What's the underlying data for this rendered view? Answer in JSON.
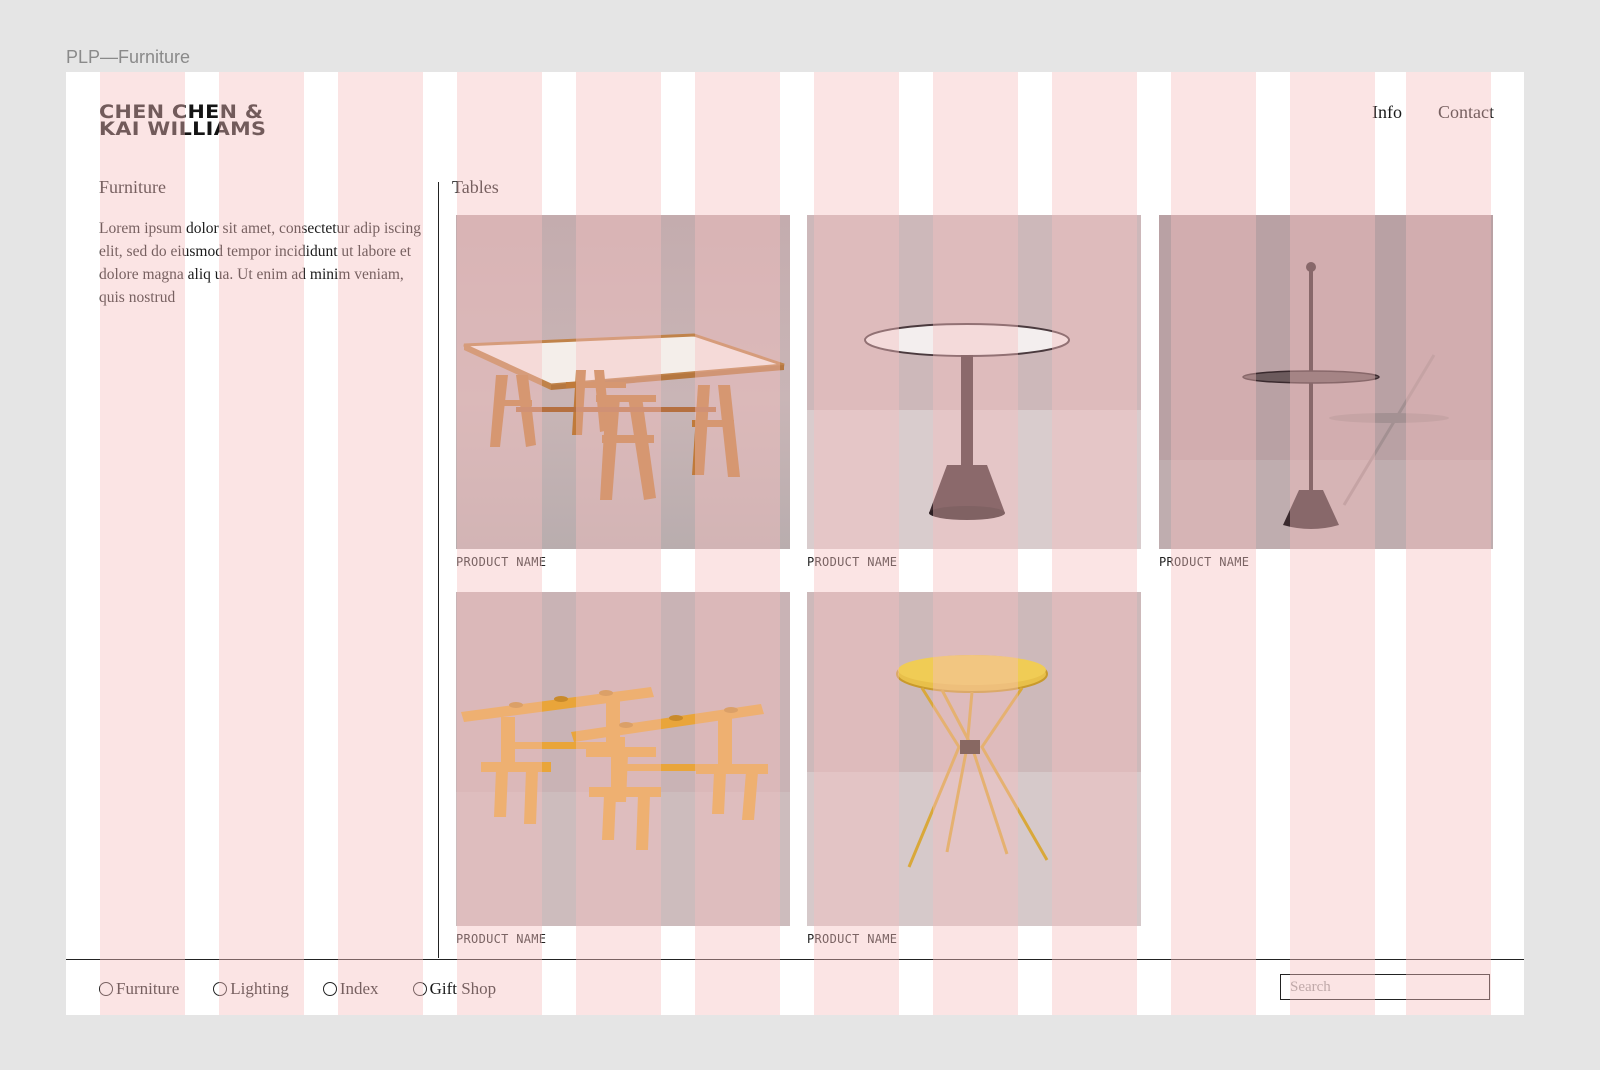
{
  "frame_label": "PLP—Furniture",
  "brand": {
    "line1": "CHEN CHEN &",
    "line2": "KAI WILLIAMS"
  },
  "topnav": {
    "info": "Info",
    "contact": "Contact"
  },
  "sidebar": {
    "title": "Furniture",
    "description": "Lorem ipsum dolor sit amet, consectetur adip iscing elit, sed do eiusmod tempor incididunt ut labore et dolore magna aliq ua. Ut enim ad minim veniam, quis nostrud"
  },
  "section": {
    "title": "Tables"
  },
  "products": [
    {
      "name": "PRODUCT NAME",
      "image": "trestle-table-photo"
    },
    {
      "name": "PRODUCT NAME",
      "image": "round-pedestal-table-photo"
    },
    {
      "name": "PRODUCT NAME",
      "image": "pole-side-table-photo"
    },
    {
      "name": "PRODUCT NAME",
      "image": "yellow-trestles-photo"
    },
    {
      "name": "PRODUCT NAME",
      "image": "yellow-folding-table-photo"
    }
  ],
  "bottomnav": {
    "items": [
      "Furniture",
      "Lighting",
      "Index",
      "Gift Shop"
    ]
  },
  "search": {
    "placeholder": "Search"
  },
  "colors": {
    "grid_overlay": "#f5bebe",
    "photo_background": "#c8b0b2",
    "divider": "#222222"
  }
}
